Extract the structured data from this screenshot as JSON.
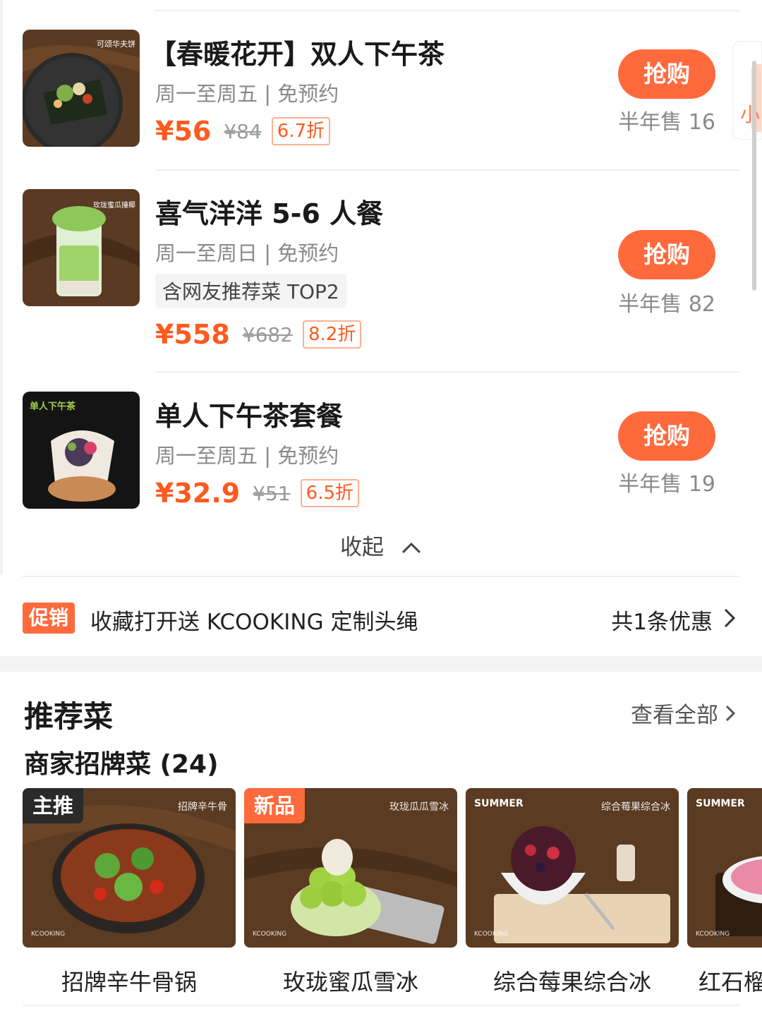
{
  "deals": [
    {
      "title": "【春暖花开】双人下午茶",
      "subtitle": "周一至周五 | 免预约",
      "tag": "",
      "price": "¥56",
      "original_price": "¥84",
      "discount": "6.7折",
      "button": "抢购",
      "sold": "半年售 16",
      "image_caption": "可颂华夫饼"
    },
    {
      "title": "喜气洋洋 5-6 人餐",
      "subtitle": "周一至周日 | 免预约",
      "tag": "含网友推荐菜 TOP2",
      "price": "¥558",
      "original_price": "¥682",
      "discount": "8.2折",
      "button": "抢购",
      "sold": "半年售 82",
      "image_caption": "玫珑蜜瓜撞椰"
    },
    {
      "title": "单人下午茶套餐",
      "subtitle": "周一至周五 | 免预约",
      "tag": "",
      "price": "¥32.9",
      "original_price": "¥51",
      "discount": "6.5折",
      "button": "抢购",
      "sold": "半年售 19",
      "image_caption": "单人下午茶"
    }
  ],
  "collapse_label": "收起",
  "promo": {
    "badge": "促销",
    "text": "收藏打开送 KCOOKING 定制头绳",
    "count": "共1条优惠"
  },
  "recommend": {
    "title": "推荐菜",
    "see_all": "查看全部",
    "subtitle": "商家招牌菜 (24)"
  },
  "dishes": [
    {
      "name": "招牌辛牛骨锅",
      "label": "主推",
      "label_color": "#2a2a2a",
      "image_caption": "招牌辛牛骨",
      "summer": ""
    },
    {
      "name": "玫珑蜜瓜雪冰",
      "label": "新品",
      "label_color": "#ff6a3d",
      "image_caption": "玫珑瓜瓜雪冰",
      "summer": ""
    },
    {
      "name": "综合莓果综合冰",
      "label": "",
      "label_color": "",
      "image_caption": "综合莓果综合冰",
      "summer": "SUMMER"
    },
    {
      "name": "红石榴",
      "label": "",
      "label_color": "",
      "image_caption": "",
      "summer": "SUMMER"
    }
  ],
  "brand_mark": "KCOOKING",
  "side_peek_text": "小",
  "colors": {
    "accent": "#ff6a3d",
    "price": "#ff5a1f",
    "muted": "#8a8a8a"
  }
}
